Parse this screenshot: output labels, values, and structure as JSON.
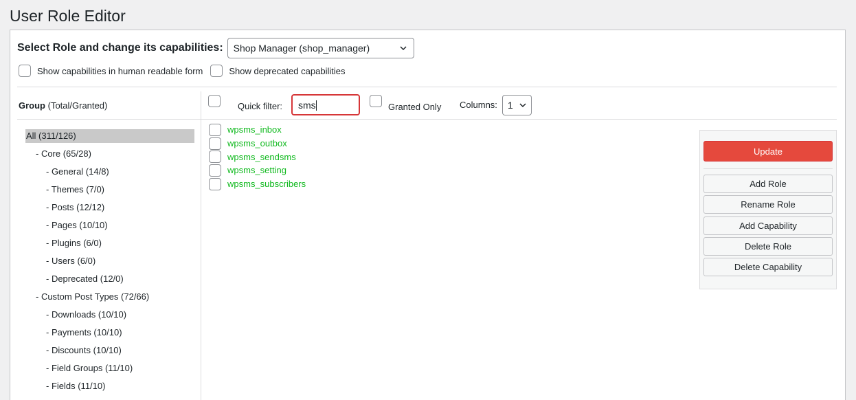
{
  "page": {
    "title": "User Role Editor"
  },
  "role": {
    "label": "Select Role and change its capabilities:",
    "selected": "Shop Manager (shop_manager)"
  },
  "options": {
    "human_readable": "Show capabilities in human readable form",
    "deprecated": "Show deprecated capabilities"
  },
  "groups": {
    "header_bold": "Group",
    "header_rest": " (Total/Granted)",
    "items": [
      {
        "label": "All (311/126)",
        "level": 0,
        "active": true
      },
      {
        "label": "- Core (65/28)",
        "level": 1
      },
      {
        "label": "- General (14/8)",
        "level": 2
      },
      {
        "label": "- Themes (7/0)",
        "level": 2
      },
      {
        "label": "- Posts (12/12)",
        "level": 2
      },
      {
        "label": "- Pages (10/10)",
        "level": 2
      },
      {
        "label": "- Plugins (6/0)",
        "level": 2
      },
      {
        "label": "- Users (6/0)",
        "level": 2
      },
      {
        "label": "- Deprecated (12/0)",
        "level": 2
      },
      {
        "label": "- Custom Post Types (72/66)",
        "level": 1
      },
      {
        "label": "- Downloads (10/10)",
        "level": 2
      },
      {
        "label": "- Payments (10/10)",
        "level": 2
      },
      {
        "label": "- Discounts (10/10)",
        "level": 2
      },
      {
        "label": "- Field Groups (11/10)",
        "level": 2
      },
      {
        "label": "- Fields (11/10)",
        "level": 2
      }
    ]
  },
  "filter": {
    "quick_filter_label": "Quick filter:",
    "quick_filter_value": "sms",
    "granted_only_label": "Granted Only",
    "columns_label": "Columns:",
    "columns_value": "1"
  },
  "capabilities": [
    "wpsms_inbox",
    "wpsms_outbox",
    "wpsms_sendsms",
    "wpsms_setting",
    "wpsms_subscribers"
  ],
  "actions": {
    "update": "Update",
    "add_role": "Add Role",
    "rename_role": "Rename Role",
    "add_capability": "Add Capability",
    "delete_role": "Delete Role",
    "delete_capability": "Delete Capability"
  },
  "colors": {
    "capability_green": "#10b91e",
    "update_red": "#e5493d",
    "filter_border": "#d63638"
  }
}
